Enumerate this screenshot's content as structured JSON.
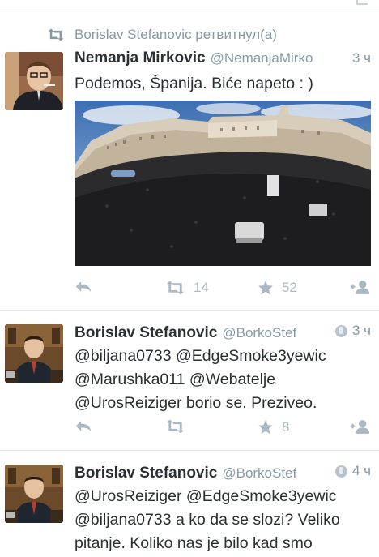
{
  "retweet_context": {
    "text": "Borislav Stefanovic ретвитнул(а)"
  },
  "tweets": [
    {
      "name": "Nemanja Mirkovic",
      "handle": "@NemanjaMirko",
      "time": "3 ч",
      "text": "Podemos, Španija. Biće napeto : )",
      "retweets": "14",
      "favorites": "52"
    },
    {
      "name": "Borislav Stefanovic",
      "handle": "@BorkoStef",
      "time": "3 ч",
      "lines": [
        "@biljana0733 @EdgeSmoke3yewic",
        "@Marushka011 @Webatelje",
        "@UrosReiziger borio se. Preziveo."
      ],
      "retweets": "",
      "favorites": "8"
    },
    {
      "name": "Borislav Stefanovic",
      "handle": "@BorkoStef",
      "time": "4 ч",
      "lines": [
        "@UrosReiziger @EdgeSmoke3yewic",
        "@biljana0733 a ko da se slozi? Veliko",
        "pitanje. Koliko nas je bilo kad smo"
      ]
    }
  ],
  "colors": {
    "muted": "#8899a6",
    "icon": "#aab8c2",
    "text": "#292f33",
    "divider": "#e1e8ed"
  }
}
